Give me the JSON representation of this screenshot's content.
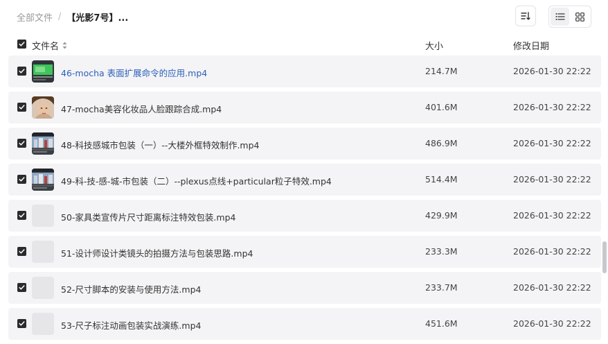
{
  "breadcrumb": {
    "root": "全部文件",
    "separator": "/",
    "current": "【光影7号】..."
  },
  "toolbar": {
    "sort_icon": "sort-icon",
    "list_icon": "list-view-icon",
    "grid_icon": "grid-view-icon",
    "active_view": "list"
  },
  "table": {
    "headers": {
      "name": "文件名",
      "size": "大小",
      "modified": "修改日期"
    },
    "rows": [
      {
        "name": "46-mocha 表面扩展命令的应用.mp4",
        "size": "214.7M",
        "modified": "2026-01-30 22:22",
        "checked": true,
        "thumbnail": "green-screen-thumb"
      },
      {
        "name": "47-mocha美容化妆品人脸跟踪合成.mp4",
        "size": "401.6M",
        "modified": "2026-01-30 22:22",
        "checked": true,
        "thumbnail": "face-thumb"
      },
      {
        "name": "48-科技感城市包装（一）--大楼外框特效制作.mp4",
        "size": "486.9M",
        "modified": "2026-01-30 22:22",
        "checked": true,
        "thumbnail": "city-thumb"
      },
      {
        "name": "49-科-技-感-城-市包装（二）--plexus点线+particular粒子特效.mp4",
        "size": "514.4M",
        "modified": "2026-01-30 22:22",
        "checked": true,
        "thumbnail": "city-thumb"
      },
      {
        "name": "50-家具类宣传片尺寸距离标注特效包装.mp4",
        "size": "429.9M",
        "modified": "2026-01-30 22:22",
        "checked": true,
        "thumbnail": ""
      },
      {
        "name": "51-设计师设计类镜头的拍摄方法与包装思路.mp4",
        "size": "233.3M",
        "modified": "2026-01-30 22:22",
        "checked": true,
        "thumbnail": ""
      },
      {
        "name": "52-尺寸脚本的安装与使用方法.mp4",
        "size": "233.7M",
        "modified": "2026-01-30 22:22",
        "checked": true,
        "thumbnail": ""
      },
      {
        "name": "53-尺子标注动画包装实战演练.mp4",
        "size": "451.6M",
        "modified": "2026-01-30 22:22",
        "checked": true,
        "thumbnail": ""
      }
    ]
  },
  "colors": {
    "row_bg": "#f4f4f6",
    "link": "#2c5fb8",
    "checkbox": "#2b2b2b"
  }
}
